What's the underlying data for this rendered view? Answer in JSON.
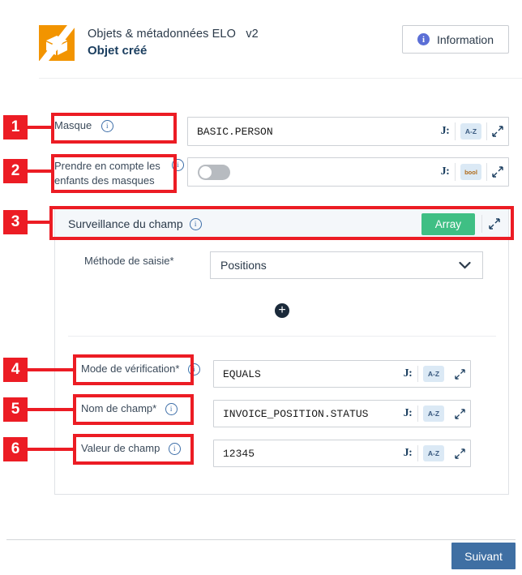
{
  "header": {
    "subtitle": "Objets & métadonnées ELO   v2",
    "title": "Objet créé",
    "info_label": "Information",
    "logo_name": "elo-cube-logo"
  },
  "rows": {
    "masque": {
      "label": "Masque",
      "value": "BASIC.PERSON",
      "type_badge": "A-Z",
      "json_icon": "J:",
      "callout": "1"
    },
    "enfants": {
      "label_line1": "Prendre en compte les",
      "label_line2": "enfants des masques",
      "toggle_state": "off",
      "type_badge": "bool",
      "json_icon": "J:",
      "callout": "2"
    },
    "surveillance": {
      "label": "Surveillance du champ",
      "badge": "Array",
      "callout": "3"
    },
    "methode": {
      "label": "Méthode de saisie*",
      "value": "Positions"
    },
    "mode_verification": {
      "label": "Mode de vérification*",
      "value": "EQUALS",
      "type_badge": "A-Z",
      "json_icon": "J:",
      "callout": "4"
    },
    "nom_champ": {
      "label": "Nom de champ*",
      "value": "INVOICE_POSITION.STATUS",
      "type_badge": "A-Z",
      "json_icon": "J:",
      "callout": "5"
    },
    "valeur_champ": {
      "label": "Valeur de champ",
      "value": "12345",
      "type_badge": "A-Z",
      "json_icon": "J:",
      "callout": "6"
    }
  },
  "add_button_label": "+",
  "footer": {
    "next_label": "Suivant"
  },
  "colors": {
    "brand_orange": "#f29400",
    "callout_red": "#ec1c24",
    "array_green": "#3fbf84",
    "primary_blue": "#3f6fa3",
    "info_blue": "#5b6fd6"
  }
}
